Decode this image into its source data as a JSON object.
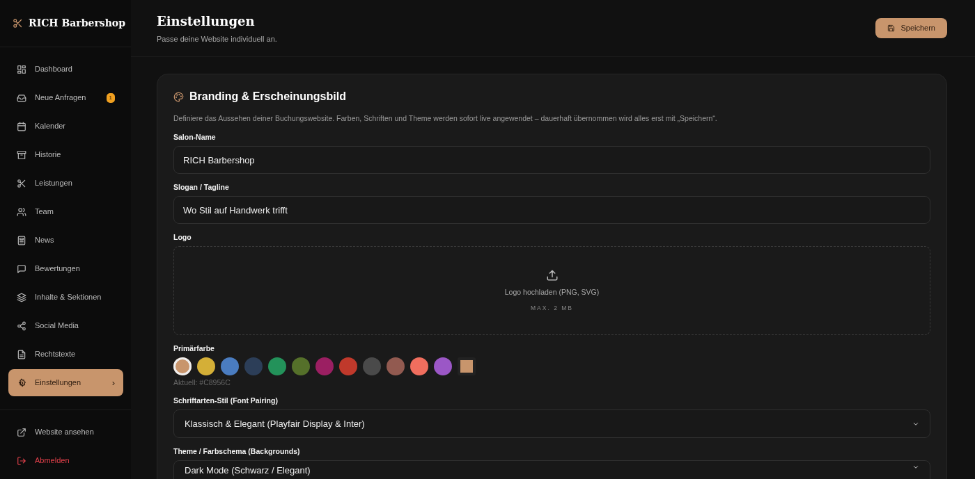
{
  "brand": {
    "name": "RICH Barbershop"
  },
  "nav": [
    {
      "label": "Dashboard",
      "selected": false
    },
    {
      "label": "Neue Anfragen",
      "selected": false,
      "badge": "1"
    },
    {
      "label": "Kalender",
      "selected": false
    },
    {
      "label": "Historie",
      "selected": false
    },
    {
      "label": "Leistungen",
      "selected": false
    },
    {
      "label": "Team",
      "selected": false
    },
    {
      "label": "News",
      "selected": false
    },
    {
      "label": "Bewertungen",
      "selected": false
    },
    {
      "label": "Inhalte & Sektionen",
      "selected": false
    },
    {
      "label": "Social Media",
      "selected": false
    },
    {
      "label": "Rechtstexte",
      "selected": false
    },
    {
      "label": "Einstellungen",
      "selected": true,
      "chevron": "›"
    }
  ],
  "footer_nav": [
    {
      "label": "Website ansehen",
      "kind": "link"
    },
    {
      "label": "Abmelden",
      "kind": "danger"
    }
  ],
  "header": {
    "title": "Einstellungen",
    "subtitle": "Passe deine Website individuell an.",
    "save_button": "Speichern"
  },
  "card": {
    "title": "Branding & Erscheinungsbild",
    "description": "Definiere das Aussehen deiner Buchungswebsite. Farben, Schriften und Theme werden sofort live angewendet – dauerhaft übernommen wird alles erst mit „Speichern“.",
    "fields": [
      {
        "label": "Salon-Name",
        "value": "RICH Barbershop"
      },
      {
        "label": "Slogan / Tagline",
        "value": "Wo Stil auf Handwerk trifft"
      }
    ],
    "logo": {
      "label": "Logo",
      "upload_text": "Logo hochladen (PNG, SVG)",
      "hint": "MAX. 2 MB"
    },
    "primary_color": {
      "label": "Primärfarbe",
      "current": "Aktuell: #C8956C",
      "swatches": [
        {
          "color": "#c8956c",
          "selected": true,
          "kind": "dot"
        },
        {
          "color": "#d4af37",
          "selected": false,
          "kind": "dot"
        },
        {
          "color": "#4a7cc0",
          "selected": false,
          "kind": "dot"
        },
        {
          "color": "#2c3e58",
          "selected": false,
          "kind": "dot"
        },
        {
          "color": "#23925a",
          "selected": false,
          "kind": "dot"
        },
        {
          "color": "#55702a",
          "selected": false,
          "kind": "dot"
        },
        {
          "color": "#9b1f62",
          "selected": false,
          "kind": "dot"
        },
        {
          "color": "#c0392b",
          "selected": false,
          "kind": "dot"
        },
        {
          "color": "#4a4a4a",
          "selected": false,
          "kind": "dot"
        },
        {
          "color": "#925a50",
          "selected": false,
          "kind": "dot"
        },
        {
          "color": "#f06e5e",
          "selected": false,
          "kind": "dot"
        },
        {
          "color": "#9b57c6",
          "selected": false,
          "kind": "dot"
        },
        {
          "color": "#c8956c",
          "selected": false,
          "kind": "picker"
        }
      ]
    },
    "selects": [
      {
        "label": "Schriftarten-Stil (Font Pairing)",
        "value": "Klassisch & Elegant (Playfair Display & Inter)"
      },
      {
        "label": "Theme / Farbschema (Backgrounds)",
        "value": "Dark Mode (Schwarz / Elegant)"
      }
    ]
  }
}
